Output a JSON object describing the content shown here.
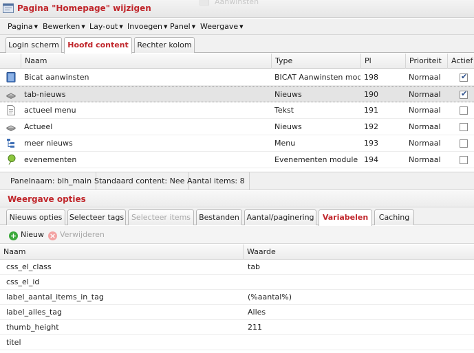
{
  "window": {
    "title": "Pagina \"Homepage\" wijzigen",
    "background_hint": "Aanwinsten"
  },
  "menu": [
    {
      "label": "Pagina"
    },
    {
      "label": "Bewerken"
    },
    {
      "label": "Lay-out"
    },
    {
      "label": "Invoegen"
    },
    {
      "label": "Panel"
    },
    {
      "label": "Weergave"
    }
  ],
  "panel_tabs": [
    {
      "label": "Login scherm",
      "active": false
    },
    {
      "label": "Hoofd content",
      "active": true
    },
    {
      "label": "Rechter kolom",
      "active": false
    }
  ],
  "content_table": {
    "columns": [
      "Naam",
      "Type",
      "Pl",
      "Prioriteit",
      "Actief"
    ],
    "rows": [
      {
        "icon": "module-icon",
        "naam": "Bicat aanwinsten",
        "type": "BICAT Aanwinsten module",
        "pl": "198",
        "prioriteit": "Normaal",
        "actief": true,
        "selected": false
      },
      {
        "icon": "news-icon",
        "naam": "tab-nieuws",
        "type": "Nieuws",
        "pl": "190",
        "prioriteit": "Normaal",
        "actief": true,
        "selected": true
      },
      {
        "icon": "text-document-icon",
        "naam": "actueel menu",
        "type": "Tekst",
        "pl": "191",
        "prioriteit": "Normaal",
        "actief": false,
        "selected": false
      },
      {
        "icon": "news-icon",
        "naam": "Actueel",
        "type": "Nieuws",
        "pl": "192",
        "prioriteit": "Normaal",
        "actief": false,
        "selected": false
      },
      {
        "icon": "menu-tree-icon",
        "naam": "meer nieuws",
        "type": "Menu",
        "pl": "193",
        "prioriteit": "Normaal",
        "actief": false,
        "selected": false
      },
      {
        "icon": "event-balloon-icon",
        "naam": "evenementen",
        "type": "Evenementen module",
        "pl": "194",
        "prioriteit": "Normaal",
        "actief": false,
        "selected": false
      }
    ]
  },
  "status": {
    "panel_name": "Panelnaam: blh_main",
    "default_content": "Standaard content: Nee",
    "item_count": "Aantal items: 8"
  },
  "options": {
    "title": "Weergave opties",
    "tabs": [
      {
        "label": "Nieuws opties",
        "active": false,
        "disabled": false
      },
      {
        "label": "Selecteer tags",
        "active": false,
        "disabled": false
      },
      {
        "label": "Selecteer items",
        "active": false,
        "disabled": true
      },
      {
        "label": "Bestanden",
        "active": false,
        "disabled": false
      },
      {
        "label": "Aantal/paginering",
        "active": false,
        "disabled": false
      },
      {
        "label": "Variabelen",
        "active": true,
        "disabled": false
      },
      {
        "label": "Caching",
        "active": false,
        "disabled": false
      }
    ],
    "toolbar": {
      "new_label": "Nieuw",
      "delete_label": "Verwijderen"
    },
    "columns": [
      "Naam",
      "Waarde"
    ],
    "variables": [
      {
        "naam": "css_el_class",
        "waarde": "tab"
      },
      {
        "naam": "css_el_id",
        "waarde": ""
      },
      {
        "naam": "label_aantal_items_in_tag",
        "waarde": "(%aantal%)"
      },
      {
        "naam": "label_alles_tag",
        "waarde": "Alles"
      },
      {
        "naam": "thumb_height",
        "waarde": "211"
      },
      {
        "naam": "titel",
        "waarde": ""
      }
    ]
  },
  "colors": {
    "accent": "#c0262b",
    "check": "#2a4e8a",
    "new_icon": "#3aa83a",
    "delete_icon_disabled": "#f3a3a3"
  }
}
